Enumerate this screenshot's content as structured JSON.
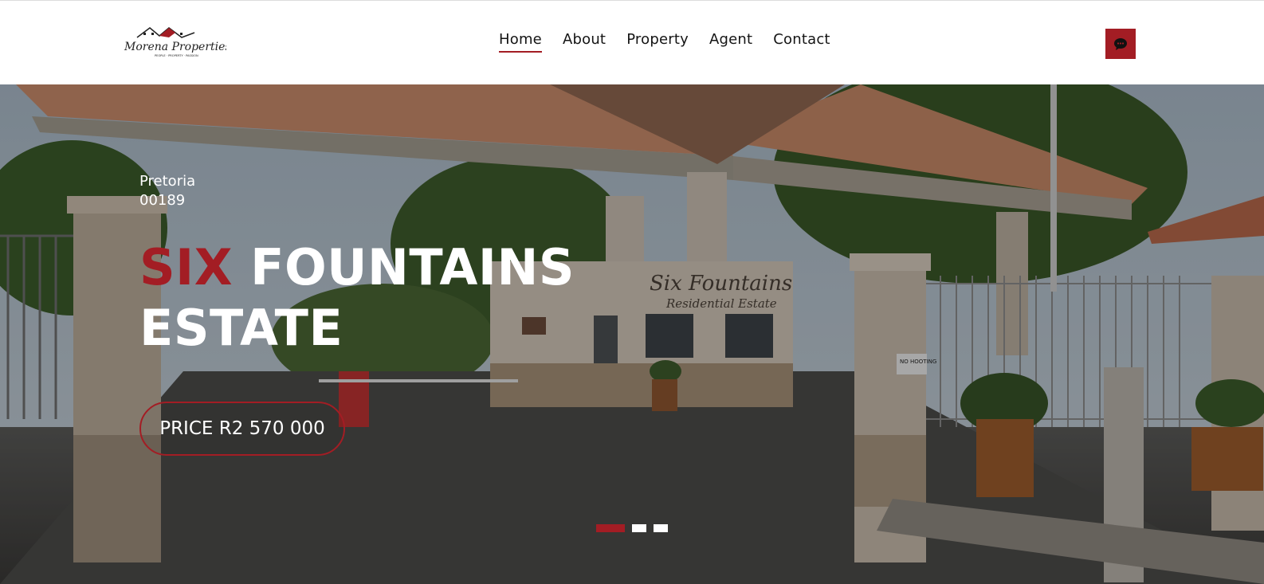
{
  "brand": {
    "logo_text": "Morena Properties",
    "tagline": "PEOPLE · PROPERTY · PASSION",
    "accent_color": "#a31d24"
  },
  "nav": {
    "items": [
      {
        "label": "Home",
        "active": true
      },
      {
        "label": "About",
        "active": false
      },
      {
        "label": "Property",
        "active": false
      },
      {
        "label": "Agent",
        "active": false
      },
      {
        "label": "Contact",
        "active": false
      }
    ]
  },
  "header_action": {
    "icon": "chat-bubble-icon"
  },
  "hero": {
    "location_line1": "Pretoria",
    "location_line2": "00189",
    "title_accent": "SIX",
    "title_rest_line1": "FOUNTAINS",
    "title_line2": "ESTATE",
    "price_label": "PRICE R2 570 000",
    "sign_text_1": "Six Fountains",
    "sign_text_2": "Residential Estate",
    "sign_no_hooting": "NO HOOTING",
    "slides": {
      "count": 3,
      "active_index": 0
    }
  }
}
